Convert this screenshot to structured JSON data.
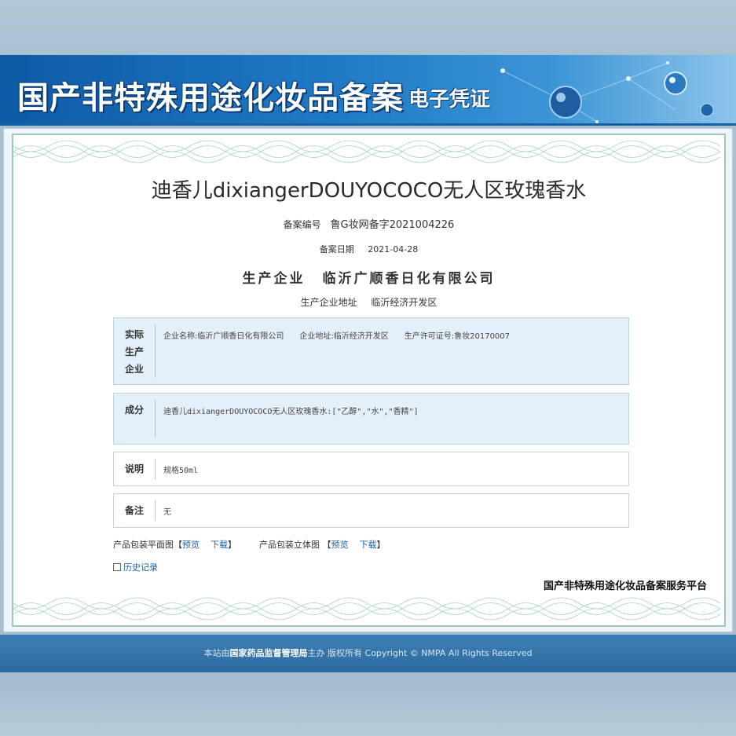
{
  "banner": {
    "title": "国产非特殊用途化妆品备案",
    "subtitle": "电子凭证"
  },
  "certificate": {
    "product_name": "迪香儿dixiangerDOUYOCOCO无人区玫瑰香水",
    "record_no_label": "备案编号",
    "record_no": "鲁G妆网备字2021004226",
    "record_date_label": "备案日期",
    "record_date": "2021-04-28",
    "producer_label": "生产企业",
    "producer": "临沂广顺香日化有限公司",
    "address_label": "生产企业地址",
    "address": "临沂经济开发区",
    "actual_producer": {
      "head": [
        "实际",
        "生产",
        "企业"
      ],
      "company": "企业名称:临沂广顺香日化有限公司",
      "address": "企业地址:临沂经济开发区",
      "license": "生产许可证号:鲁妆20170007"
    },
    "ingredients": {
      "head": "成分",
      "text": "迪香儿dixiangerDOUYOCOCO无人区玫瑰香水:[\"乙醇\",\"水\",\"香精\"]"
    },
    "description": {
      "head": "说明",
      "text": "规格50ml"
    },
    "remarks": {
      "head": "备注",
      "text": "无"
    },
    "package": {
      "flat_label": "产品包装平面图",
      "stereo_label": "产品包装立体图",
      "preview": "预览",
      "download": "下载",
      "open": "【",
      "close": "】"
    },
    "history": "历史记录",
    "platform": "国产非特殊用途化妆品备案服务平台"
  },
  "footer": {
    "prefix": "本站由",
    "org": "国家药品监督管理局",
    "suffix": "主办 版权所有 Copyright © NMPA All Rights Reserved"
  },
  "colors": {
    "banner": "#1f79c4",
    "link": "#1a5fa8",
    "box_blue": "#e3eff9",
    "footer": "#2c6aa0"
  }
}
